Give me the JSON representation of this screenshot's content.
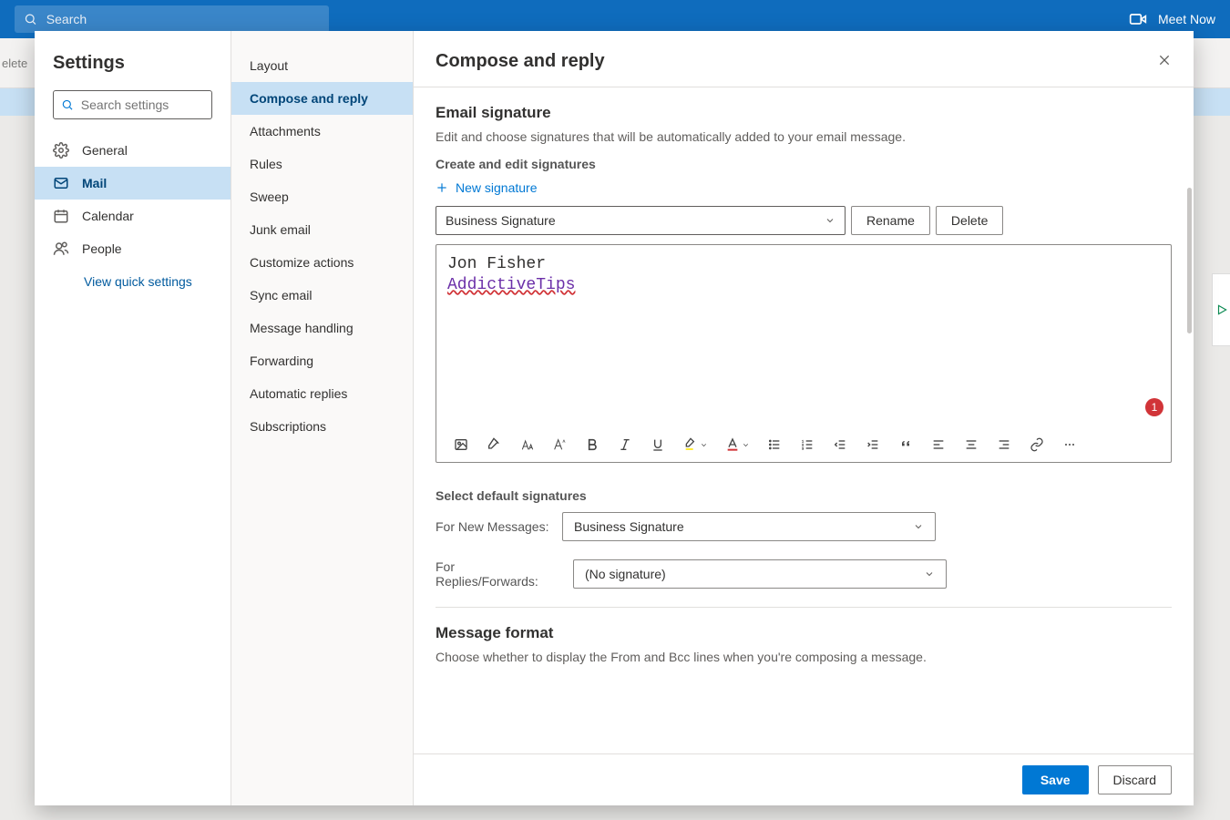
{
  "topbar": {
    "search_placeholder": "Search",
    "meet_now": "Meet Now"
  },
  "bg": {
    "toolbar_fragment": "elete"
  },
  "settings": {
    "title": "Settings",
    "search_placeholder": "Search settings",
    "categories": [
      {
        "label": "General"
      },
      {
        "label": "Mail"
      },
      {
        "label": "Calendar"
      },
      {
        "label": "People"
      }
    ],
    "quick_link": "View quick settings"
  },
  "subnav": [
    "Layout",
    "Compose and reply",
    "Attachments",
    "Rules",
    "Sweep",
    "Junk email",
    "Customize actions",
    "Sync email",
    "Message handling",
    "Forwarding",
    "Automatic replies",
    "Subscriptions"
  ],
  "panel": {
    "title": "Compose and reply",
    "section1": {
      "title": "Email signature",
      "desc": "Edit and choose signatures that will be automatically added to your email message.",
      "create_edit": "Create and edit signatures",
      "new_signature": "New signature",
      "selected_signature": "Business Signature",
      "rename": "Rename",
      "delete": "Delete",
      "editor": {
        "line1": "Jon Fisher",
        "line2": "AddictiveTips"
      },
      "badge": "1"
    },
    "defaults": {
      "title": "Select default signatures",
      "new_label": "For New Messages:",
      "new_value": "Business Signature",
      "reply_label": "For Replies/Forwards:",
      "reply_value": "(No signature)"
    },
    "section2": {
      "title": "Message format",
      "desc": "Choose whether to display the From and Bcc lines when you're composing a message."
    }
  },
  "footer": {
    "save": "Save",
    "discard": "Discard"
  }
}
